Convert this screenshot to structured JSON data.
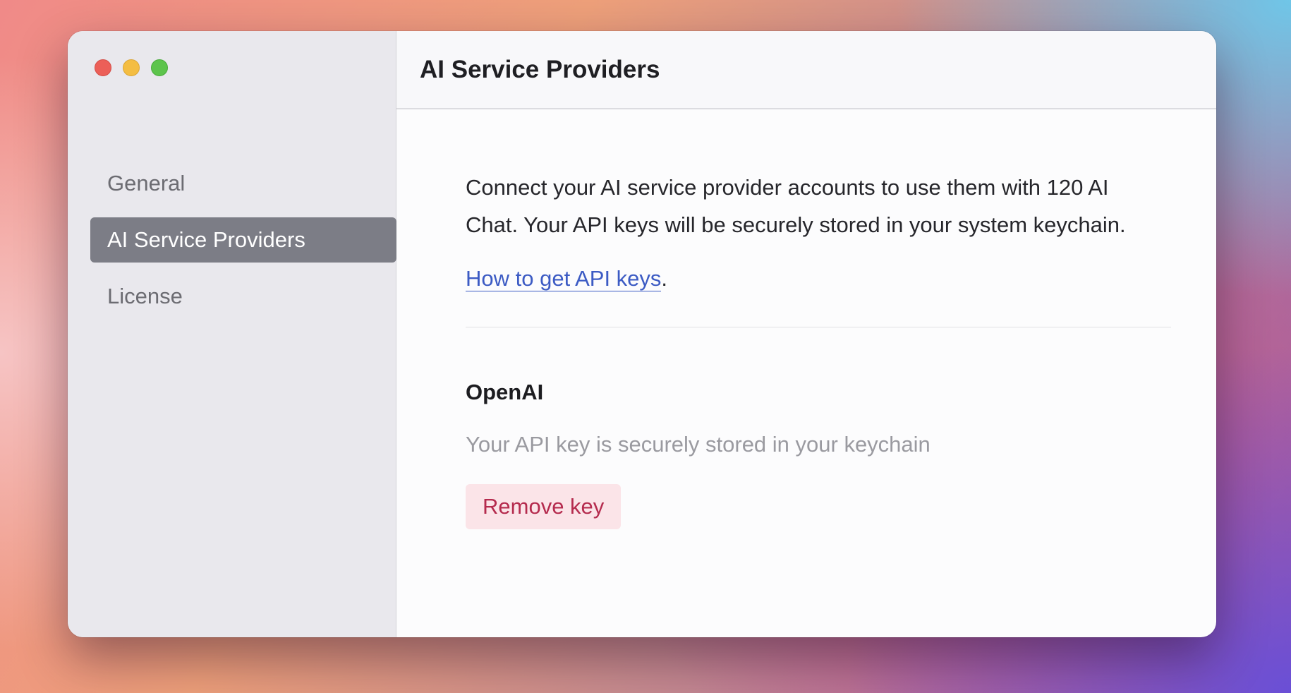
{
  "window": {
    "controls": [
      "close",
      "minimize",
      "maximize"
    ]
  },
  "sidebar": {
    "items": [
      {
        "label": "General",
        "active": false
      },
      {
        "label": "AI Service Providers",
        "active": true
      },
      {
        "label": "License",
        "active": false
      }
    ]
  },
  "header": {
    "title": "AI Service Providers"
  },
  "main": {
    "intro": "Connect your AI service provider accounts to use them with 120 AI Chat. Your API keys will be securely stored in your system keychain.",
    "help_link": "How to get API keys",
    "help_suffix": ".",
    "providers": [
      {
        "name": "OpenAI",
        "status": "Your API key is securely stored in your keychain",
        "action_label": "Remove key"
      }
    ]
  },
  "colors": {
    "accent_link": "#3c5bc4",
    "danger": "#b52b4e",
    "danger_bg": "#fbe4e8",
    "sidebar_active": "#7c7d86"
  }
}
